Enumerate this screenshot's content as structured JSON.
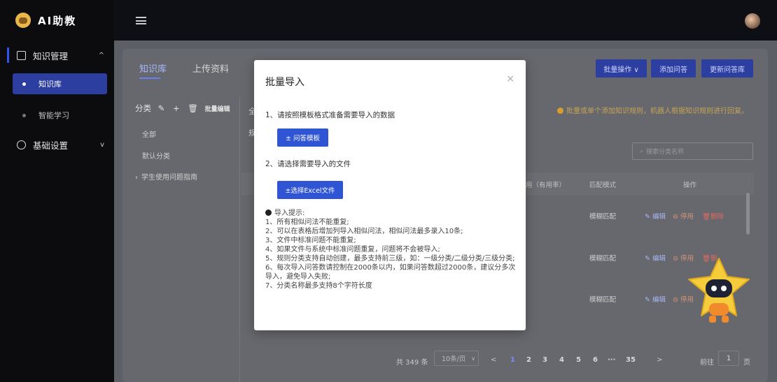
{
  "app": {
    "name": "AI助教"
  },
  "sidebar": {
    "groups": [
      {
        "label": "知识管理",
        "arrow": "^"
      },
      {
        "label": "基础设置",
        "arrow": "v"
      }
    ],
    "items": [
      {
        "label": "知识库"
      },
      {
        "label": "智能学习"
      }
    ]
  },
  "tabs": [
    {
      "label": "知识库"
    },
    {
      "label": "上传资料"
    }
  ],
  "header_buttons": {
    "batch": "批量操作 ∨",
    "add": "添加问答",
    "update": "更新问答库"
  },
  "notice": "批量或单个添加知识规则，机器人根据知识规则进行回复。",
  "category": {
    "head": "分类",
    "batch_edit": "批量编辑",
    "all_trunc": "全",
    "rule_trunc": "规",
    "items": [
      "全部",
      "默认分类",
      "学生使用问题指南"
    ]
  },
  "search": {
    "placeholder": "搜索分类名称"
  },
  "table": {
    "headers": [
      "用（有用率）",
      "匹配模式",
      "操作"
    ],
    "rows": [
      {
        "mode": "模糊匹配",
        "edit": "编辑",
        "disable": "停用",
        "delete": "删除"
      },
      {
        "mode": "模糊匹配",
        "edit": "编辑",
        "disable": "停用",
        "delete": "删"
      },
      {
        "mode": "模糊匹配",
        "edit": "编辑",
        "disable": "停用",
        "delete": ""
      }
    ]
  },
  "pagination": {
    "total": "共 349 条",
    "page_size": "10条/页",
    "pages": [
      "1",
      "2",
      "3",
      "4",
      "5",
      "6",
      "···",
      "35"
    ],
    "prev": "<",
    "next": ">",
    "goto_label": "前往",
    "goto_value": "1",
    "page_suffix": "页"
  },
  "modal": {
    "title": "批量导入",
    "close": "×",
    "step1": "1、请按照模板格式准备需要导入的数据",
    "template_button": "± 问答模板",
    "step2": "2、请选择需要导入的文件",
    "choose_button": "±选择Excel文件",
    "tips_title": "导入提示:",
    "tips": [
      "1、所有相似问法不能重复;",
      "2、可以在表格后增加列导入相似问法，相似问法最多录入10条;",
      "3、文件中标准问题不能重复;",
      "4、如果文件与系统中标准问题重复，问题将不会被导入;",
      "5、规则分类支持自动创建，最多支持前三级，如：一级分类/二级分类/三级分类;",
      "6、每次导入问答数请控制在2000条以内，如果问答数超过2000条，建议分多次导入，避免导入失败;",
      "7、分类名称最多支持8个字符长度"
    ]
  }
}
